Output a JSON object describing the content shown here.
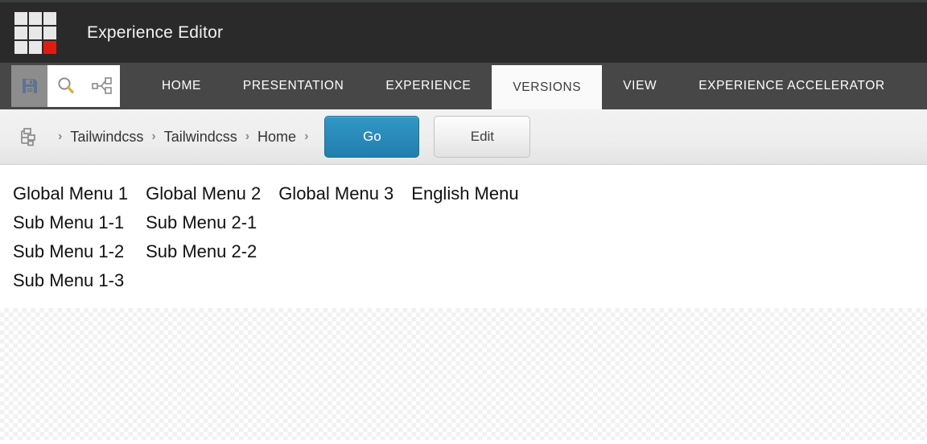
{
  "titlebar": {
    "app_title": "Experience Editor",
    "logo_name": "sitecore-logo",
    "logo_accent_color": "#e21b12"
  },
  "ribbon": {
    "quick_access": [
      {
        "name": "save-icon",
        "label": "Save",
        "active": true
      },
      {
        "name": "search-icon",
        "label": "Search",
        "active": false
      },
      {
        "name": "sitemap-icon",
        "label": "Navigate",
        "active": false
      }
    ],
    "tabs": [
      {
        "label": "HOME",
        "active": false
      },
      {
        "label": "PRESENTATION",
        "active": false
      },
      {
        "label": "EXPERIENCE",
        "active": false
      },
      {
        "label": "VERSIONS",
        "active": true
      },
      {
        "label": "VIEW",
        "active": false
      },
      {
        "label": "EXPERIENCE ACCELERATOR",
        "active": false
      }
    ],
    "active_tab_color": "#fafafa",
    "bar_color": "#474747"
  },
  "breadcrumb": {
    "icon_name": "content-tree-icon",
    "separator": "›",
    "items": [
      {
        "label": "Tailwindcss"
      },
      {
        "label": "Tailwindcss"
      },
      {
        "label": "Home"
      }
    ],
    "go_button": "Go",
    "edit_button": "Edit",
    "go_button_color": "#2a8bba"
  },
  "content": {
    "columns": [
      {
        "items": [
          "Global Menu 1",
          "Sub Menu 1-1",
          "Sub Menu 1-2",
          "Sub Menu 1-3"
        ]
      },
      {
        "items": [
          "Global Menu 2",
          "Sub Menu 2-1",
          "Sub Menu 2-2"
        ]
      },
      {
        "items": [
          "Global Menu 3"
        ]
      },
      {
        "items": [
          "English Menu"
        ]
      }
    ]
  },
  "empty_area": {
    "name": "transparent-placeholder-region"
  }
}
